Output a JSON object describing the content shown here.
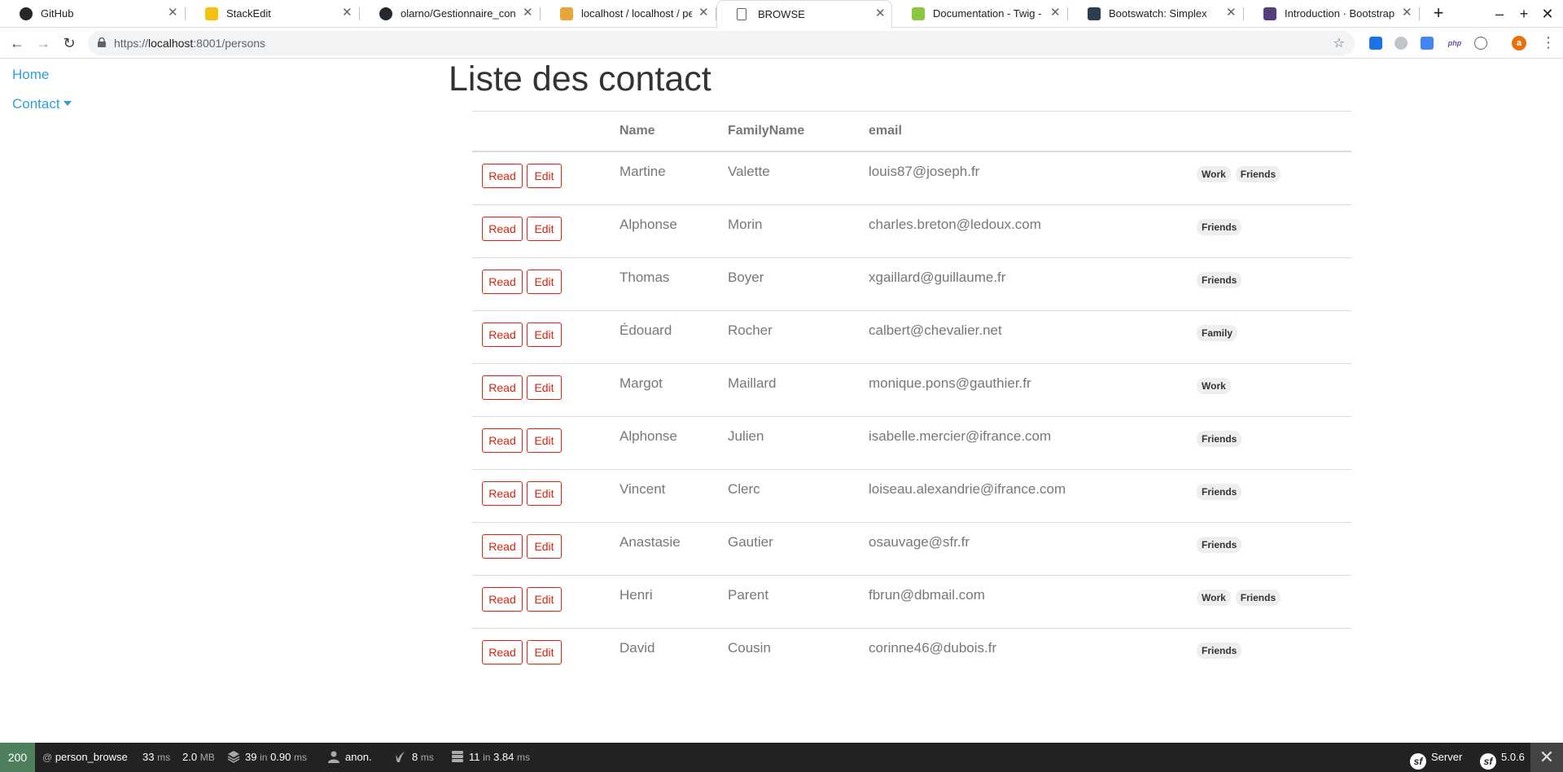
{
  "browser": {
    "tabs": [
      {
        "title": "GitHub",
        "icon": "github-icon"
      },
      {
        "title": "StackEdit",
        "icon": "stackedit-icon"
      },
      {
        "title": "olarno/Gestionnaire_contac",
        "icon": "github-icon"
      },
      {
        "title": "localhost / localhost / perso",
        "icon": "phpmyadmin-icon"
      },
      {
        "title": "BROWSE",
        "icon": "page-icon"
      },
      {
        "title": "Documentation - Twig - The",
        "icon": "twig-icon"
      },
      {
        "title": "Bootswatch: Simplex",
        "icon": "bootswatch-icon"
      },
      {
        "title": "Introduction · Bootstrap",
        "icon": "bootstrap-icon"
      }
    ],
    "url_scheme": "https://",
    "url_host": "localhost",
    "url_rest": ":8001/persons",
    "profile_initial": "a",
    "ext_php_label": "php"
  },
  "nav": {
    "home": "Home",
    "contact": "Contact"
  },
  "page": {
    "title": "Liste des contact"
  },
  "table": {
    "headers": {
      "name": "Name",
      "family_name": "FamilyName",
      "email": "email"
    },
    "read_label": "Read",
    "edit_label": "Edit",
    "rows": [
      {
        "name": "Martine",
        "family": "Valette",
        "email": "louis87@joseph.fr",
        "tags": [
          "Work",
          "Friends"
        ]
      },
      {
        "name": "Alphonse",
        "family": "Morin",
        "email": "charles.breton@ledoux.com",
        "tags": [
          "Friends"
        ]
      },
      {
        "name": "Thomas",
        "family": "Boyer",
        "email": "xgaillard@guillaume.fr",
        "tags": [
          "Friends"
        ]
      },
      {
        "name": "Édouard",
        "family": "Rocher",
        "email": "calbert@chevalier.net",
        "tags": [
          "Family"
        ]
      },
      {
        "name": "Margot",
        "family": "Maillard",
        "email": "monique.pons@gauthier.fr",
        "tags": [
          "Work"
        ]
      },
      {
        "name": "Alphonse",
        "family": "Julien",
        "email": "isabelle.mercier@ifrance.com",
        "tags": [
          "Friends"
        ]
      },
      {
        "name": "Vincent",
        "family": "Clerc",
        "email": "loiseau.alexandrie@ifrance.com",
        "tags": [
          "Friends"
        ]
      },
      {
        "name": "Anastasie",
        "family": "Gautier",
        "email": "osauvage@sfr.fr",
        "tags": [
          "Friends"
        ]
      },
      {
        "name": "Henri",
        "family": "Parent",
        "email": "fbrun@dbmail.com",
        "tags": [
          "Work",
          "Friends"
        ]
      },
      {
        "name": "David",
        "family": "Cousin",
        "email": "corinne46@dubois.fr",
        "tags": [
          "Friends"
        ]
      }
    ]
  },
  "debug_bar": {
    "status": "200",
    "route_prefix": "@",
    "route": "person_browse",
    "time_value": "33",
    "time_unit": "ms",
    "memory_value": "2.0",
    "memory_unit": "MB",
    "cache_count": "39",
    "cache_in": "in",
    "cache_time": "0.90",
    "cache_unit": "ms",
    "user": "anon.",
    "twig_time": "8",
    "twig_unit": "ms",
    "db_count": "11",
    "db_in": "in",
    "db_time": "3.84",
    "db_unit": "ms",
    "server_label": "Server",
    "symfony_version": "5.0.6"
  },
  "colors": {
    "link": "#2f9ed8",
    "danger": "#d9230f",
    "status_ok": "#4f805d"
  }
}
